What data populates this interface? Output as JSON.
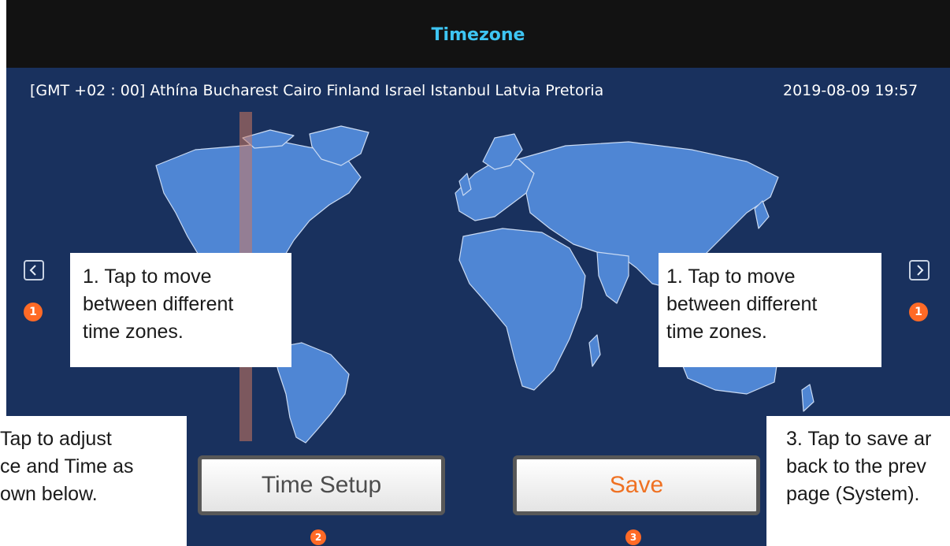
{
  "header": {
    "title": "Timezone"
  },
  "info": {
    "timezone": "[GMT +02 : 00] Athína Bucharest Cairo Finland Israel Istanbul Latvia Pretoria",
    "datetime": "2019-08-09 19:57"
  },
  "callouts": {
    "left_move": [
      "1. Tap to move",
      "between different",
      "time zones."
    ],
    "right_move": [
      "1. Tap to move",
      "between different",
      "time zones."
    ],
    "time_setup": [
      "Tap to adjust",
      "ce and Time as",
      "own below."
    ],
    "save": [
      "3. Tap to save ar",
      "back to the prev",
      "page (System)."
    ]
  },
  "buttons": {
    "time_setup": "Time Setup",
    "save": "Save"
  },
  "markers": {
    "m1": "1",
    "m2": "2",
    "m3": "3"
  },
  "icons": {
    "prev": "chevron-left-icon",
    "next": "chevron-right-icon"
  },
  "colors": {
    "header_text": "#3ec5f3",
    "save_text": "#ef7122",
    "marker": "#ff6a26",
    "background": "#19315e"
  }
}
